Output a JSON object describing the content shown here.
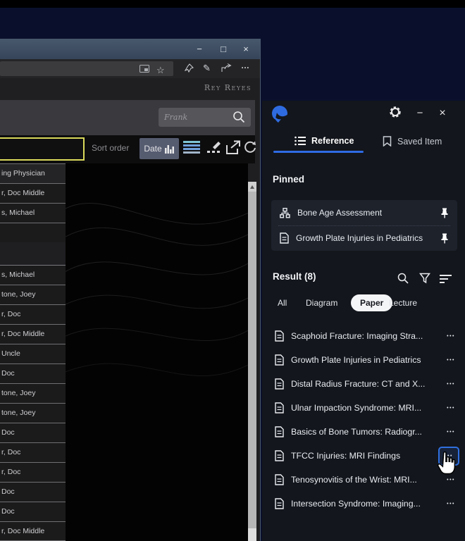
{
  "browser": {
    "window_controls": {
      "minimize": "−",
      "maximize": "□",
      "close": "×"
    },
    "address_bar": {
      "star_glyph": "☆",
      "pen_glyph": "✎",
      "ellipsis_glyph": "…"
    },
    "user_label": "Rey Reyes",
    "content_search": {
      "placeholder": "Frank"
    },
    "sort_bar": {
      "label": "Sort order",
      "date_button": "Date"
    },
    "patients": [
      "ing Physician",
      "r, Doc Middle",
      "s, Michael",
      "",
      "s, Michael",
      "tone, Joey",
      "r, Doc",
      "r, Doc Middle",
      "Uncle",
      "Doc",
      "tone, Joey",
      "tone, Joey",
      "Doc",
      "r, Doc",
      "r, Doc",
      "Doc",
      "Doc",
      "r, Doc Middle"
    ]
  },
  "panel": {
    "window_controls": {
      "minimize": "−",
      "close": "×"
    },
    "tabs": {
      "reference": "Reference",
      "saved": "Saved Item"
    },
    "pinned": {
      "heading": "Pinned",
      "items": [
        {
          "title": "Bone Age Assessment",
          "icon": "hierarchy-icon"
        },
        {
          "title": "Growth Plate Injuries in Pediatrics",
          "icon": "document-icon"
        }
      ]
    },
    "results": {
      "heading": "Result (8)",
      "filters": {
        "all": "All",
        "diagram": "Diagram",
        "paper": "Paper",
        "lecture": "Lecture"
      },
      "selected_filter": "Paper",
      "ellipsis_glyph": "•••",
      "items": [
        {
          "title": "Scaphoid Fracture: Imaging Stra..."
        },
        {
          "title": "Growth Plate Injuries in Pediatrics"
        },
        {
          "title": "Distal Radius Fracture: CT and X..."
        },
        {
          "title": "Ulnar Impaction Syndrome: MRI..."
        },
        {
          "title": "Basics of Bone Tumors: Radiogr..."
        },
        {
          "title": "TFCC Injuries: MRI Findings",
          "focused": true
        },
        {
          "title": "Tenosynovitis of the Wrist: MRI..."
        },
        {
          "title": "Intersection Syndrome: Imaging..."
        }
      ]
    }
  },
  "colors": {
    "accent_blue": "#2e6be5",
    "highlight_yellow": "#d9d95a",
    "panel_bg": "#13161c",
    "card_bg": "#1d222b",
    "chip_selected_bg": "#f4f5f7",
    "titlebar_blue": "#48586c"
  }
}
